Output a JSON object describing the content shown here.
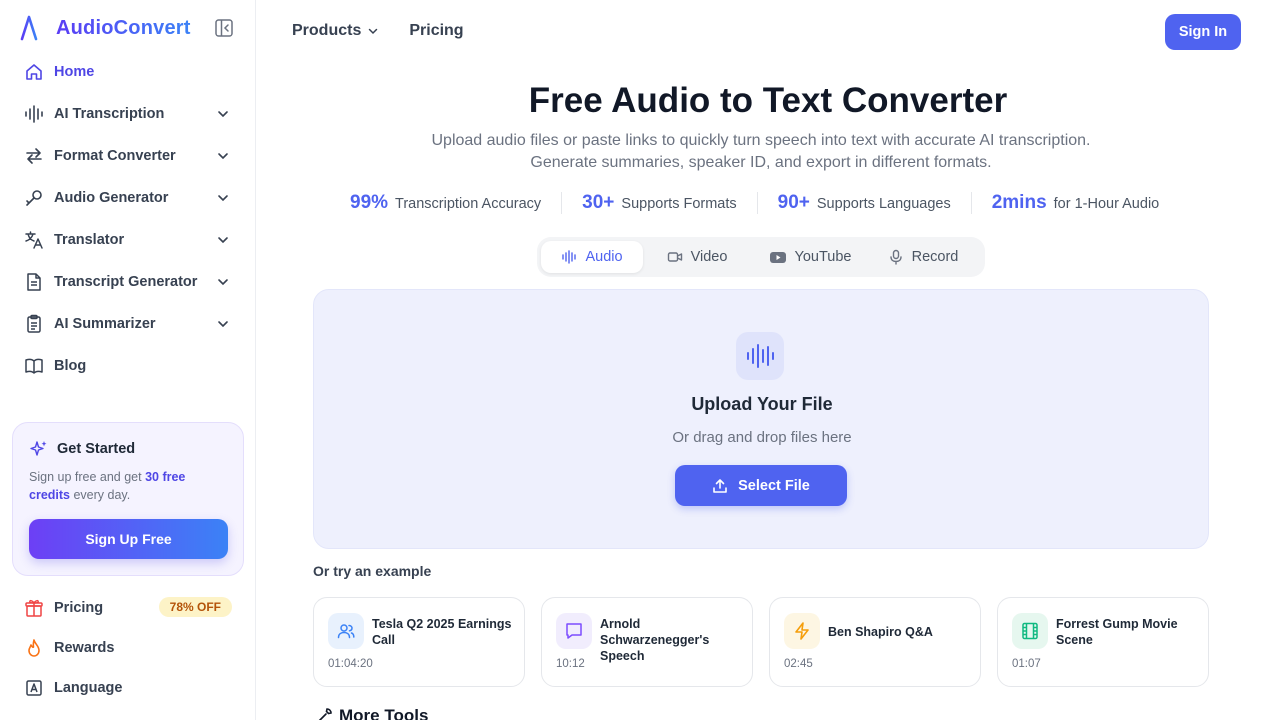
{
  "brand": {
    "name": "AudioConvert"
  },
  "sidebar": {
    "items": [
      {
        "label": "Home",
        "icon": "home-icon",
        "active": true
      },
      {
        "label": "AI Transcription",
        "icon": "waveform-icon"
      },
      {
        "label": "Format Converter",
        "icon": "swap-icon"
      },
      {
        "label": "Audio Generator",
        "icon": "pen-icon"
      },
      {
        "label": "Translator",
        "icon": "translate-icon"
      },
      {
        "label": "Transcript Generator",
        "icon": "document-icon"
      },
      {
        "label": "AI Summarizer",
        "icon": "clipboard-icon"
      },
      {
        "label": "Blog",
        "icon": "book-icon"
      }
    ],
    "promo": {
      "title": "Get Started",
      "text_before": "Sign up free and get ",
      "text_highlight": "30 free credits",
      "text_after": " every day.",
      "button": "Sign Up Free"
    },
    "bottom": [
      {
        "label": "Pricing",
        "icon": "gift-icon",
        "badge": "78% OFF"
      },
      {
        "label": "Rewards",
        "icon": "flame-icon"
      },
      {
        "label": "Language",
        "icon": "language-icon"
      }
    ]
  },
  "topnav": {
    "products": "Products",
    "pricing": "Pricing",
    "signin": "Sign In"
  },
  "hero": {
    "title": "Free Audio to Text Converter",
    "subtitle_line1": "Upload audio files or paste links to quickly turn speech into text with accurate AI transcription.",
    "subtitle_line2": "Generate summaries, speaker ID, and export in different formats."
  },
  "stats": [
    {
      "value": "99%",
      "label": "Transcription Accuracy"
    },
    {
      "value": "30+",
      "label": "Supports Formats"
    },
    {
      "value": "90+",
      "label": "Supports Languages"
    },
    {
      "value": "2mins",
      "label": "for 1-Hour Audio"
    }
  ],
  "tabs": [
    {
      "label": "Audio",
      "icon": "waveform-icon",
      "active": true
    },
    {
      "label": "Video",
      "icon": "video-icon"
    },
    {
      "label": "YouTube",
      "icon": "youtube-icon"
    },
    {
      "label": "Record",
      "icon": "mic-icon"
    }
  ],
  "upload": {
    "title": "Upload Your File",
    "subtitle": "Or drag and drop files here",
    "button": "Select File"
  },
  "examples": {
    "label": "Or try an example",
    "items": [
      {
        "title": "Tesla Q2 2025 Earnings Call",
        "duration": "01:04:20",
        "icon": "users-icon"
      },
      {
        "title": "Arnold Schwarzenegger's Speech",
        "duration": "10:12",
        "icon": "chat-icon"
      },
      {
        "title": "Ben Shapiro Q&A",
        "duration": "02:45",
        "icon": "lightning-icon"
      },
      {
        "title": "Forrest Gump Movie Scene",
        "duration": "01:07",
        "icon": "film-icon"
      }
    ]
  },
  "more_tools": "More Tools",
  "colors": {
    "primary": "#4f63f0",
    "accent_purple": "#6d3ff5",
    "promo_bg": "#f5f3ff",
    "upload_bg": "#eef0fd"
  }
}
